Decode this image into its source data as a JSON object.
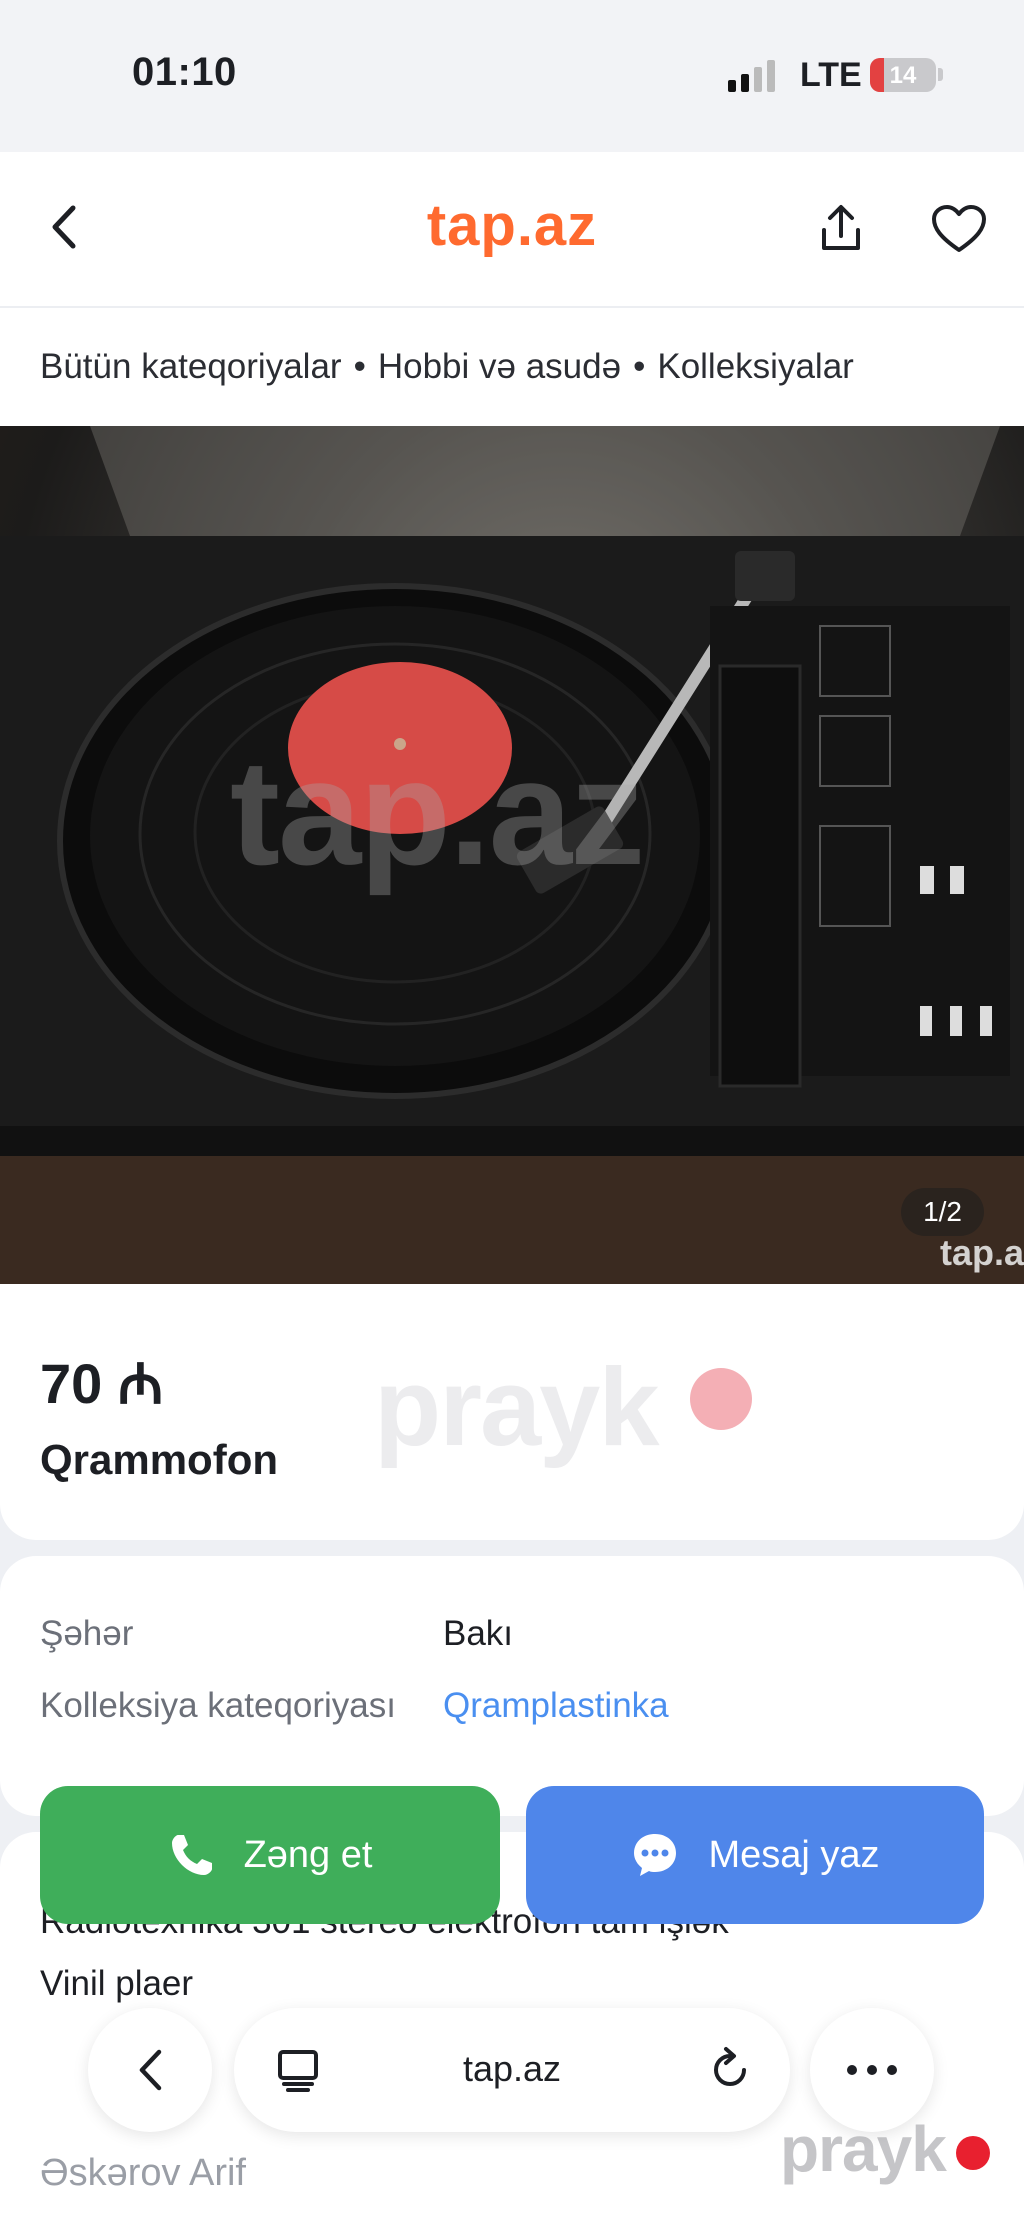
{
  "status_bar": {
    "time": "01:10",
    "network": "LTE",
    "battery_level": "14"
  },
  "nav": {
    "logo": "tap.az",
    "back_icon": "chevron-left-icon",
    "share_icon": "share-icon",
    "favorite_icon": "heart-icon"
  },
  "breadcrumb": [
    "Bütün kateqoriyalar",
    "Hobbi və asudə",
    "Kolleksiyalar"
  ],
  "breadcrumb_separator": "•",
  "gallery": {
    "counter": "1/2",
    "watermark": "tap.az",
    "corner_watermark": "tap.a"
  },
  "listing": {
    "price": "70 ₼",
    "title": "Qrammofon",
    "watermark": "prayk"
  },
  "details": [
    {
      "label": "Şəhər",
      "value": "Bakı"
    },
    {
      "label": "Kolleksiya kateqoriyası",
      "value": "Qramplastinka"
    }
  ],
  "description": {
    "line1": "Radiotexnika 301 stereo elektrofon tam işlək",
    "line2": "Vinil plaer"
  },
  "seller": {
    "name": "Əskərov Arif"
  },
  "actions": {
    "call_label": "Zəng et",
    "message_label": "Mesaj yaz"
  },
  "browser": {
    "url": "tap.az"
  },
  "overlay_watermark": "prayk",
  "colors": {
    "brand": "#ff6a2f",
    "call": "#3fae5a",
    "message": "#4f86ea",
    "link": "#4a8ff0"
  }
}
